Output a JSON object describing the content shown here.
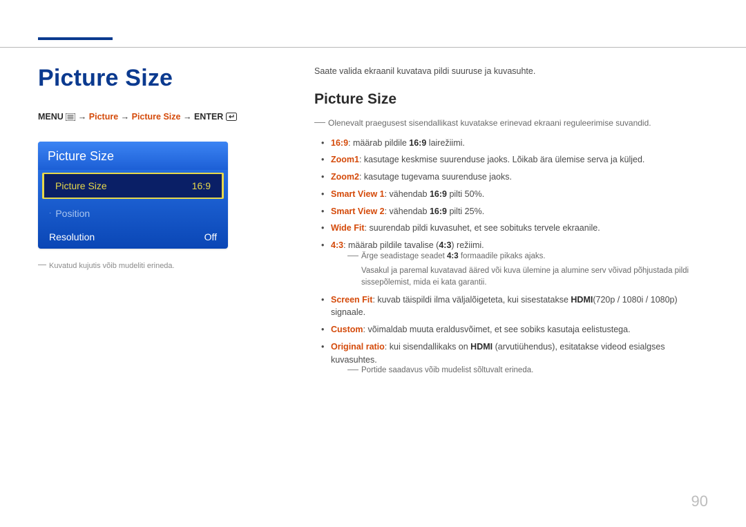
{
  "page_number": "90",
  "left": {
    "heading": "Picture Size",
    "breadcrumb": {
      "menu": "MENU",
      "p1": "Picture",
      "p2": "Picture Size",
      "enter": "ENTER"
    },
    "panel": {
      "title": "Picture Size",
      "rows": [
        {
          "label": "Picture Size",
          "value": "16:9",
          "mode": "selected"
        },
        {
          "label": "Position",
          "value": "",
          "mode": "dim",
          "dot": true
        },
        {
          "label": "Resolution",
          "value": "Off",
          "mode": "normal"
        }
      ]
    },
    "caption": "Kuvatud kujutis võib mudeliti erineda."
  },
  "right": {
    "intro": "Saate valida ekraanil kuvatava pildi suuruse ja kuvasuhte.",
    "heading": "Picture Size",
    "note_top": "Olenevalt praegusest sisendallikast kuvatakse erinevad ekraani reguleerimise suvandid.",
    "items": [
      {
        "key": "16:9",
        "text": ": määrab pildile ",
        "strong2": "16:9",
        "tail": " lairežiimi."
      },
      {
        "key": "Zoom1",
        "text": ": kasutage keskmise suurenduse jaoks. Lõikab ära ülemise serva ja küljed."
      },
      {
        "key": "Zoom2",
        "text": ": kasutage tugevama suurenduse jaoks."
      },
      {
        "key": "Smart View 1",
        "text": ": vähendab ",
        "strong2": "16:9",
        "tail": " pilti 50%."
      },
      {
        "key": "Smart View 2",
        "text": ": vähendab ",
        "strong2": "16:9",
        "tail": " pilti 25%."
      },
      {
        "key": "Wide Fit",
        "text": ": suurendab pildi kuvasuhet, et see sobituks tervele ekraanile."
      },
      {
        "key": "4:3",
        "text": ": määrab pildile tavalise (",
        "strong2": "4:3",
        "tail": ") režiimi."
      },
      {
        "key": "Screen Fit",
        "text": ": kuvab täispildi ilma väljalõigeteta, kui sisestatakse ",
        "strong2": "HDMI",
        "tail": "(720p / 1080i / 1080p) signaale."
      },
      {
        "key": "Custom",
        "text": ": võimaldab muuta eraldusvõimet, et see sobiks kasutaja eelistustega."
      },
      {
        "key": "Original ratio",
        "text": ": kui sisendallikaks on ",
        "strong2": "HDMI",
        "tail": " (arvutiühendus), esitatakse videod esialgses kuvasuhtes."
      }
    ],
    "sub43_a_pre": "Ärge seadistage seadet ",
    "sub43_a_strong": "4:3",
    "sub43_a_post": " formaadile pikaks ajaks.",
    "sub43_b": "Vasakul ja paremal kuvatavad ääred või kuva ülemine ja alumine serv võivad põhjustada pildi sissepõlemist, mida ei kata garantii.",
    "note_bottom": "Portide saadavus võib mudelist sõltuvalt erineda."
  }
}
